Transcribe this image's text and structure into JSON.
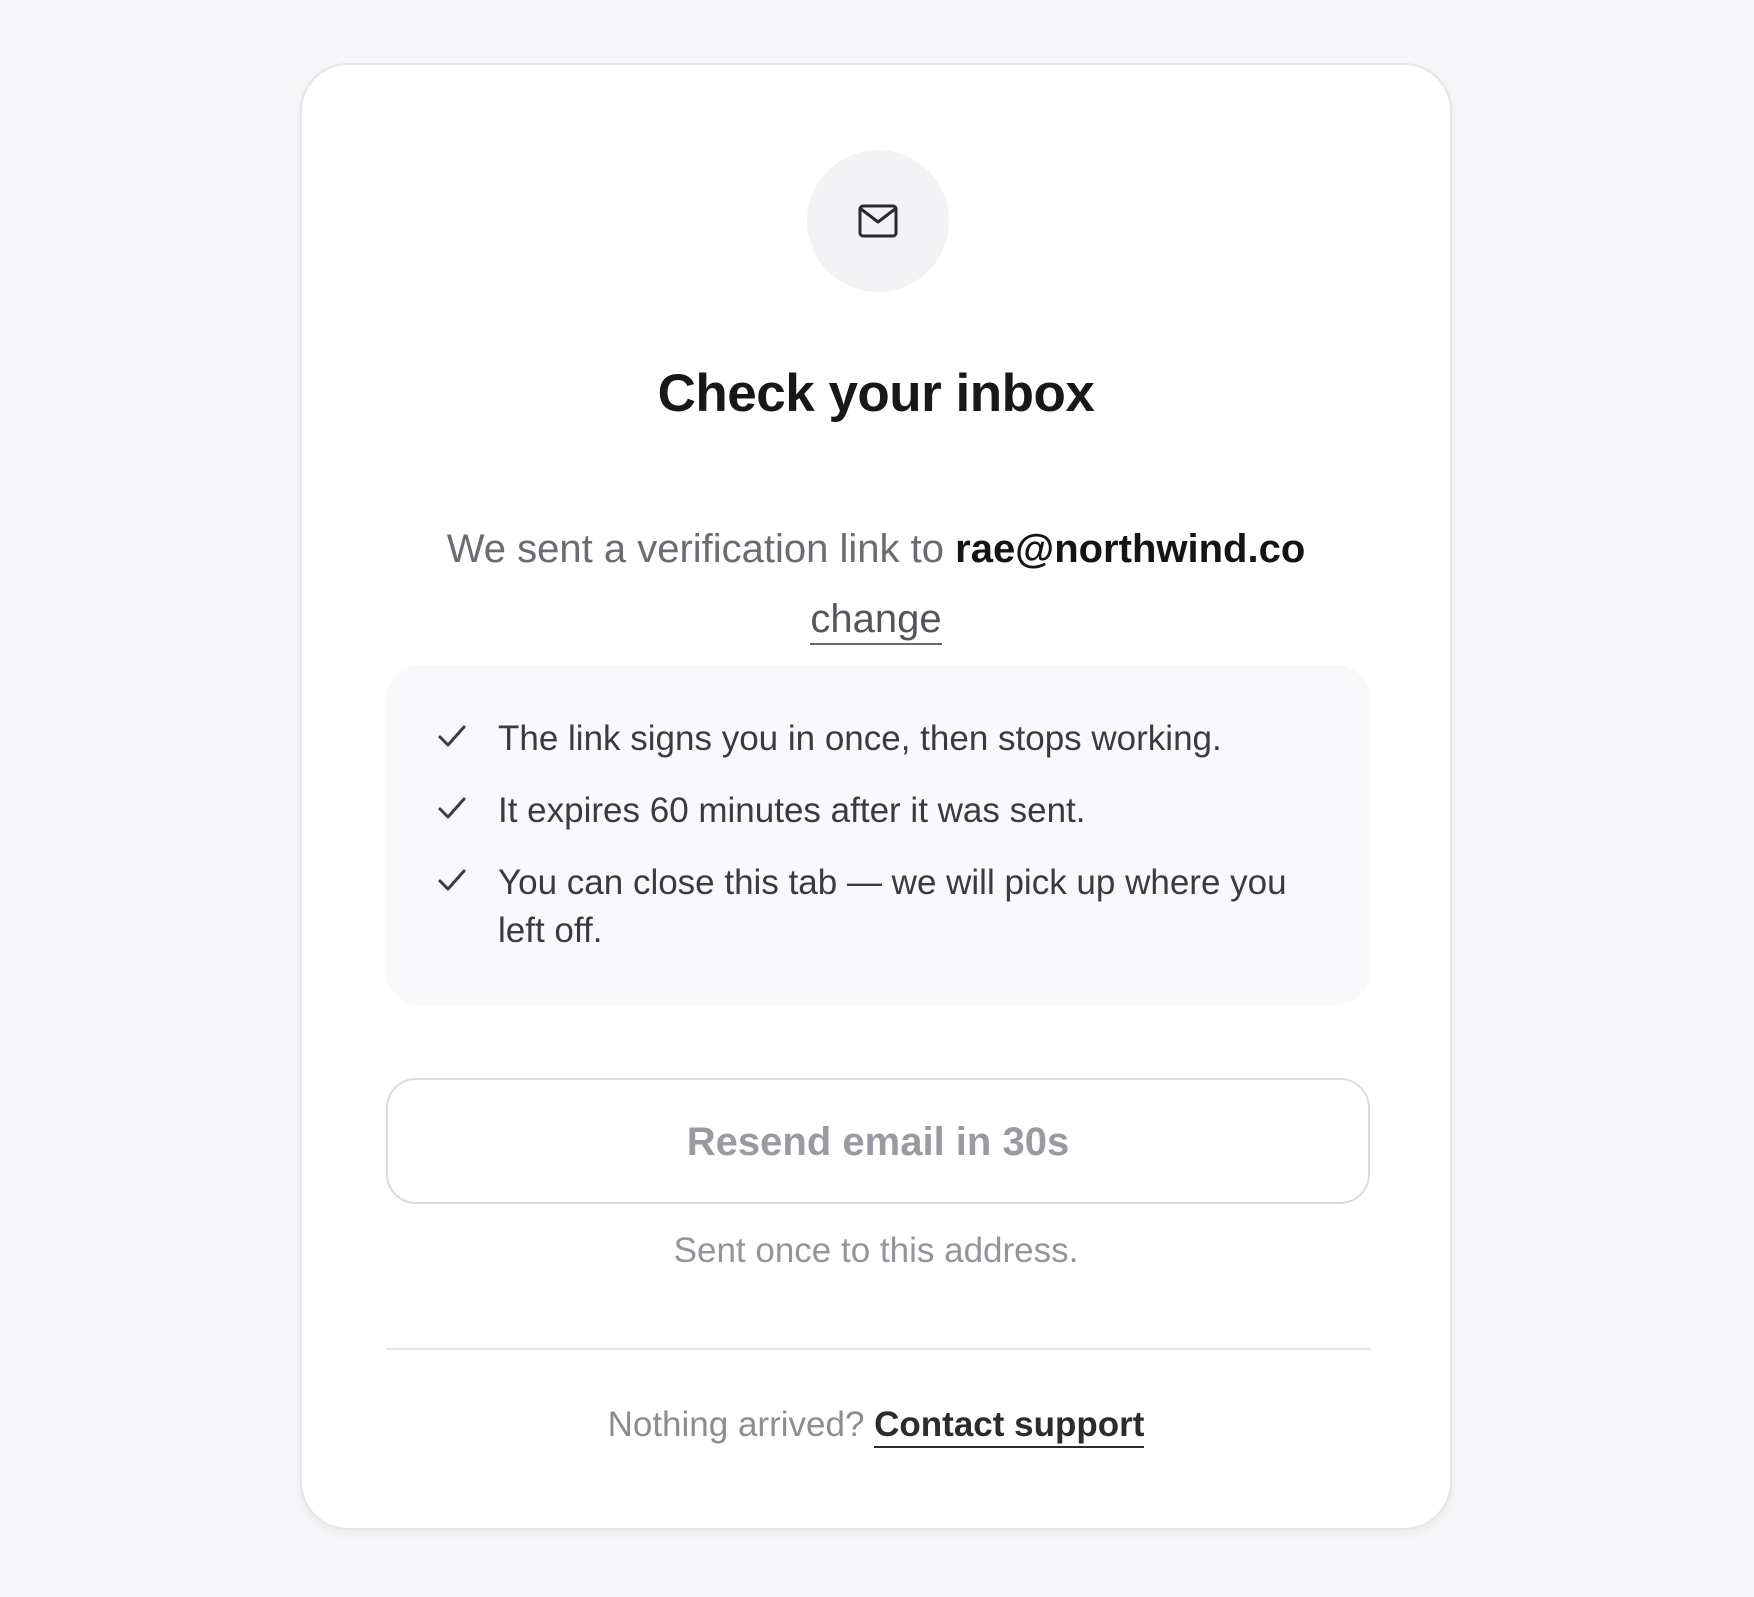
{
  "card": {
    "icon": "mail-icon",
    "title": "Check your inbox",
    "subtitle_prefix": "We sent a verification link to",
    "email": "rae@northwind.co",
    "change_label": "change",
    "info_items": [
      {
        "icon": "check-icon",
        "text": "The link signs you in once, then stops working."
      },
      {
        "icon": "check-icon",
        "text": "It expires 60 minutes after it was sent."
      },
      {
        "icon": "check-icon",
        "text": "You can close this tab — we will pick up where you left off."
      }
    ],
    "resend_label": "Resend email in 30s",
    "sent_note": "Sent once to this address.",
    "footer_prefix": "Nothing arrived?",
    "support_label": "Contact support"
  },
  "colors": {
    "page_background": "#f7f6f8",
    "card_background": "#ffffff",
    "title_text": "#18181b",
    "muted_text": "#6b6b73",
    "disabled_button_text": "#9b9aa2"
  }
}
